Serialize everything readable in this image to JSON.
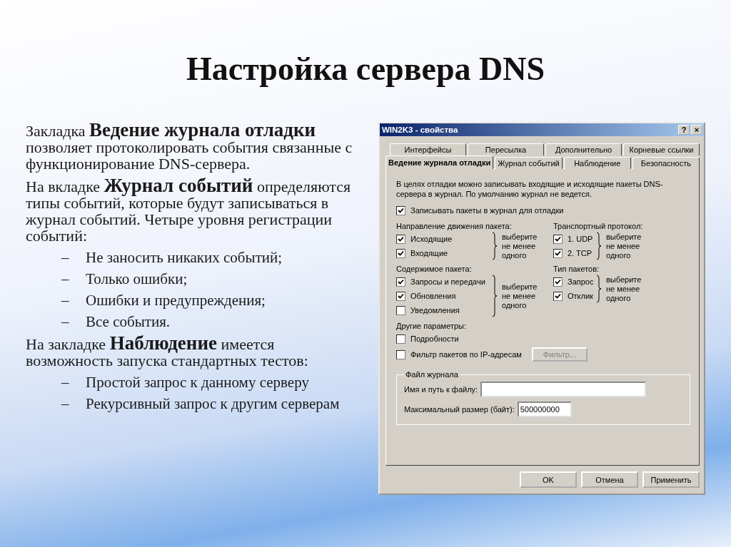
{
  "slide": {
    "title": "Настройка сервера DNS",
    "body": [
      {
        "kind": "paragraph",
        "text": "Закладка **Ведение журнала отладки** позволяет протоколировать события связанные с функционирование DNS-сервера."
      },
      {
        "kind": "paragraph",
        "text": "На вкладке **Журнал событий** определяются типы событий, которые будут записываться в журнал событий. Четыре уровня регистрации событий:"
      },
      {
        "kind": "bullet",
        "marker": "–",
        "text": "Не заносить никаких событий;"
      },
      {
        "kind": "bullet",
        "marker": "–",
        "text": "Только ошибки;"
      },
      {
        "kind": "bullet",
        "marker": "–",
        "text": "Ошибки и предупреждения;"
      },
      {
        "kind": "bullet",
        "marker": "–",
        "text": "Все события."
      },
      {
        "kind": "paragraph",
        "text": "На закладке **Наблюдение** имеется возможность запуска стандартных тестов:"
      },
      {
        "kind": "bullet",
        "marker": "–",
        "text": "Простой запрос  к данному серверу"
      },
      {
        "kind": "bullet",
        "marker": "–",
        "text": "Рекурсивный запрос к другим серверам"
      }
    ]
  },
  "dialog": {
    "title": "WIN2K3 - свойства",
    "help": "?",
    "close": "×",
    "tab_rows": [
      [
        {
          "label": "Интерфейсы",
          "selected": false
        },
        {
          "label": "Пересылка",
          "selected": false
        },
        {
          "label": "Дополнительно",
          "selected": false
        },
        {
          "label": "Корневые ссылки",
          "selected": false
        }
      ],
      [
        {
          "label": "Ведение журнала отладки",
          "selected": true
        },
        {
          "label": "Журнал событий",
          "selected": false
        },
        {
          "label": "Наблюдение",
          "selected": false
        },
        {
          "label": "Безопасность",
          "selected": false
        }
      ]
    ],
    "intro": "В целях отладки можно записывать входящие и исходящие пакеты DNS-сервера в журнал. По умолчанию журнал не ведется.",
    "main_option": {
      "label": "Записывать пакеты в журнал для отладки",
      "checked": true
    },
    "groups": [
      {
        "label": "Направление движения пакета:",
        "hint": "выберите не менее одного",
        "options": [
          {
            "label": "Исходящие",
            "checked": true
          },
          {
            "label": "Входящие",
            "checked": true
          }
        ]
      },
      {
        "label": "Транспортный протокол:",
        "hint": "выберите не менее одного",
        "options": [
          {
            "label": "1. UDP",
            "checked": true
          },
          {
            "label": "2. TCP",
            "checked": true
          }
        ]
      },
      {
        "label": "Содержимое пакета:",
        "hint": "выберите не менее одного",
        "options": [
          {
            "label": "Запросы и передачи",
            "checked": true
          },
          {
            "label": "Обновления",
            "checked": true
          },
          {
            "label": "Уведомления",
            "checked": false
          }
        ]
      },
      {
        "label": "Тип пакетов:",
        "hint": "выберите не менее одного",
        "options": [
          {
            "label": "Запрос",
            "checked": true
          },
          {
            "label": "Отклик",
            "checked": true
          }
        ]
      }
    ],
    "other": {
      "label": "Другие параметры:",
      "options": [
        {
          "label": "Подробности",
          "checked": false
        },
        {
          "label": "Фильтр пакетов по IP-адресам",
          "checked": false,
          "button": {
            "label": "Фильтр...",
            "disabled": true
          }
        }
      ]
    },
    "log_file": {
      "legend": "Файл журнала",
      "fields": [
        {
          "label": "Имя и путь к файлу:"
        },
        {
          "label": "Максимальный размер (байт):",
          "value": "500000000"
        }
      ]
    },
    "buttons": [
      "OK",
      "Отмена",
      "Применить"
    ]
  }
}
